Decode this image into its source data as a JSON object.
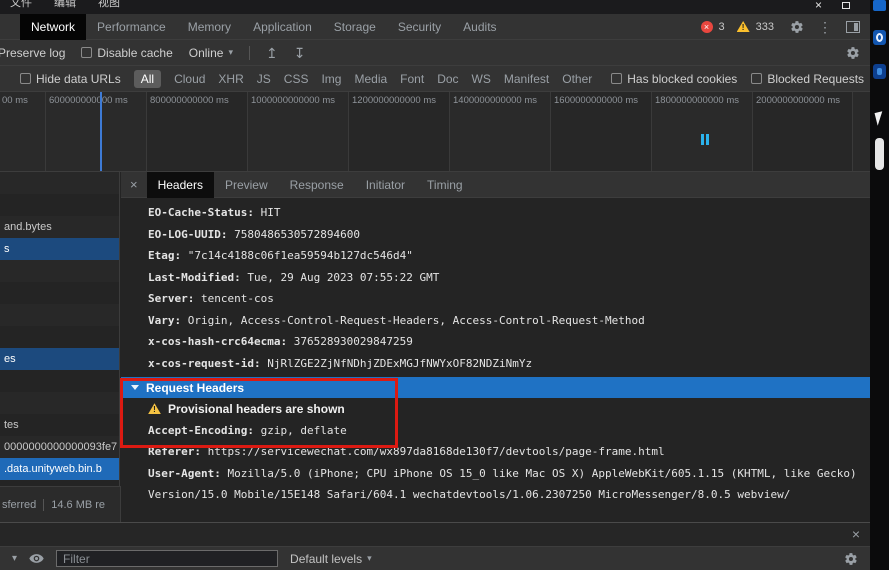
{
  "window": {
    "menu_items": [
      "文件",
      "编辑",
      "视图"
    ],
    "close": "×"
  },
  "devtools": {
    "tabs": [
      "Network",
      "Performance",
      "Memory",
      "Application",
      "Storage",
      "Security",
      "Audits"
    ],
    "active_tab": "Network",
    "error_icon": "×",
    "error_count": "3",
    "warning_count": "333",
    "menu_dots": "⋮"
  },
  "network_toolbar": {
    "preserve_log": "Preserve log",
    "disable_cache": "Disable cache",
    "throttling": "Online",
    "import_arrow": "↥",
    "export_arrow": "↧"
  },
  "filter_bar": {
    "hide_data_urls": "Hide data URLs",
    "all_label": "All",
    "types": [
      "Cloud",
      "XHR",
      "JS",
      "CSS",
      "Img",
      "Media",
      "Font",
      "Doc",
      "WS",
      "Manifest",
      "Other"
    ],
    "has_blocked_cookies": "Has blocked cookies",
    "blocked_requests": "Blocked Requests"
  },
  "timeline": {
    "partial_label": "00 ms",
    "labels": [
      "600000000000 ms",
      "800000000000 ms",
      "1000000000000 ms",
      "1200000000000 ms",
      "1400000000000 ms",
      "1600000000000 ms",
      "1800000000000 ms",
      "2000000000000 ms"
    ]
  },
  "request_list": {
    "rows": [
      {
        "label": ""
      },
      {
        "label": ""
      },
      {
        "label": "and.bytes"
      },
      {
        "label": "s"
      },
      {
        "label": ""
      },
      {
        "label": ""
      },
      {
        "label": ""
      },
      {
        "label": ""
      },
      {
        "label": "es"
      },
      {
        "label": ""
      },
      {
        "label": ""
      },
      {
        "label": "tes"
      },
      {
        "label": "0000000000000093fe7"
      },
      {
        "label": ".data.unityweb.bin.b"
      }
    ],
    "footer_left": "sferred",
    "footer_right": "14.6 MB re"
  },
  "details": {
    "close": "×",
    "tabs": [
      "Headers",
      "Preview",
      "Response",
      "Initiator",
      "Timing"
    ],
    "active_tab": "Headers",
    "response_headers": [
      {
        "name": "EO-Cache-Status",
        "value": "HIT"
      },
      {
        "name": "EO-LOG-UUID",
        "value": "7580486530572894600"
      },
      {
        "name": "Etag",
        "value": "\"7c14c4188c06f1ea59594b127dc546d4\""
      },
      {
        "name": "Last-Modified",
        "value": "Tue, 29 Aug 2023 07:55:22 GMT"
      },
      {
        "name": "Server",
        "value": "tencent-cos"
      },
      {
        "name": "Vary",
        "value": "Origin, Access-Control-Request-Headers, Access-Control-Request-Method"
      },
      {
        "name": "x-cos-hash-crc64ecma",
        "value": "376528930029847259"
      },
      {
        "name": "x-cos-request-id",
        "value": "NjRlZGE2ZjNfNDhjZDExMGJfNWYxOF82NDZiNmYz"
      }
    ],
    "request_headers": {
      "section_title": "Request Headers",
      "warning": "Provisional headers are shown",
      "headers": [
        {
          "name": "Accept-Encoding",
          "value": "gzip, deflate"
        },
        {
          "name": "Referer",
          "value": "https://servicewechat.com/wx897da8168de130f7/devtools/page-frame.html"
        },
        {
          "name": "User-Agent",
          "value": "Mozilla/5.0 (iPhone; CPU iPhone OS 15_0 like Mac OS X) AppleWebKit/605.1.15 (KHTML, like Gecko) Version/15.0 Mobile/15E148 Safari/604.1 wechatdevtools/1.06.2307250 MicroMessenger/8.0.5 webview/"
        }
      ]
    }
  },
  "console_drawer": {
    "close": "×",
    "context_caret": "▾",
    "filter_placeholder": "Filter",
    "levels_label": "Default levels"
  },
  "colors": {
    "accent_blue": "#1f72c4",
    "selected_row_blue": "#1f6ab8",
    "annotation_red": "#dc1a12",
    "warning_yellow": "#f5c242",
    "error_red": "#e9473f"
  }
}
